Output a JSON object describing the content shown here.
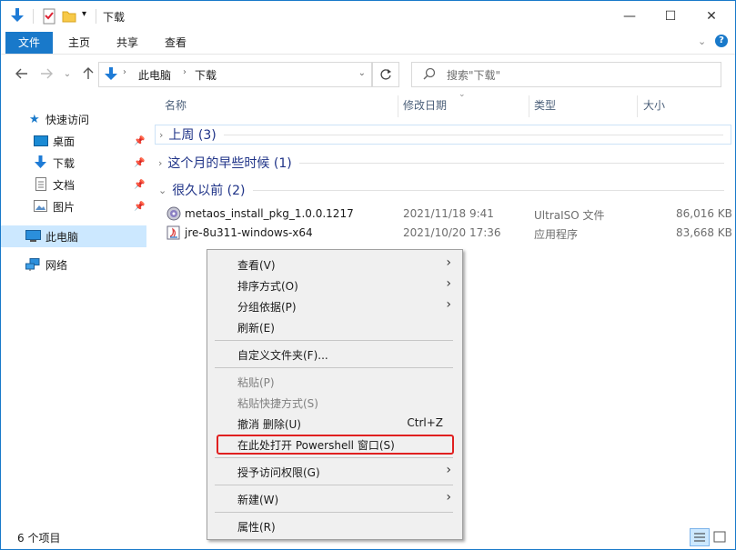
{
  "window": {
    "title": "下载",
    "minimize": "—",
    "maximize": "☐",
    "close": "✕"
  },
  "ribbon": {
    "tabs": [
      "文件",
      "主页",
      "共享",
      "查看"
    ],
    "help": "?"
  },
  "address": {
    "path": [
      "此电脑",
      "下载"
    ],
    "search_placeholder": "搜索\"下载\""
  },
  "nav": {
    "quick_access": "快速访问",
    "items": [
      "桌面",
      "下载",
      "文档",
      "图片"
    ],
    "this_pc": "此电脑",
    "network": "网络"
  },
  "columns": {
    "name": "名称",
    "date": "修改日期",
    "type": "类型",
    "size": "大小"
  },
  "groups": [
    {
      "label": "上周 (3)"
    },
    {
      "label": "这个月的早些时候 (1)"
    },
    {
      "label": "很久以前 (2)"
    }
  ],
  "files": [
    {
      "name": "metaos_install_pkg_1.0.0.1217",
      "date": "2021/11/18 9:41",
      "type": "UltraISO 文件",
      "size": "86,016 KB",
      "icon": "disc-icon"
    },
    {
      "name": "jre-8u311-windows-x64",
      "date": "2021/10/20 17:36",
      "type": "应用程序",
      "size": "83,668 KB",
      "icon": "installer-icon"
    }
  ],
  "status": {
    "count": "6 个项目"
  },
  "context_menu": {
    "items": [
      {
        "label": "查看(V)",
        "arrow": "›"
      },
      {
        "label": "排序方式(O)",
        "arrow": "›"
      },
      {
        "label": "分组依据(P)",
        "arrow": "›"
      },
      {
        "label": "刷新(E)"
      },
      {
        "label": "自定义文件夹(F)..."
      },
      {
        "label": "粘贴(P)"
      },
      {
        "label": "粘贴快捷方式(S)"
      },
      {
        "label": "撤消 删除(U)",
        "shortcut": "Ctrl+Z"
      },
      {
        "label": "在此处打开 Powershell 窗口(S)"
      },
      {
        "label": "授予访问权限(G)",
        "arrow": "›"
      },
      {
        "label": "新建(W)",
        "arrow": "›"
      },
      {
        "label": "属性(R)"
      }
    ]
  },
  "colors": {
    "accent": "#1979ca",
    "selected": "#cce8ff",
    "highlight_box": "#e02020",
    "group_text": "#1e3287"
  }
}
